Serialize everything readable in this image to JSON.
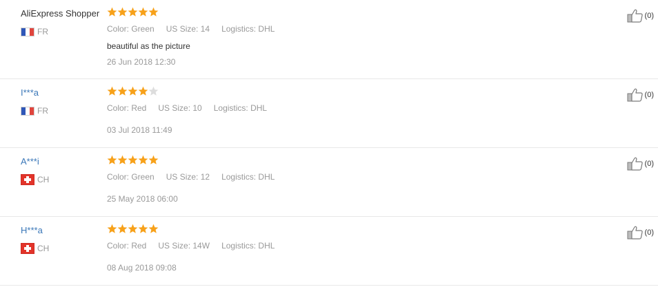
{
  "reviews": [
    {
      "user": "AliExpress Shopper",
      "country": "FR",
      "flag": "france-flag",
      "rating": 5,
      "color": "Color: Green",
      "size": "US Size: 14",
      "logistics": "Logistics: DHL",
      "feedback": "beautiful as the picture",
      "date": "26 Jun 2018 12:30",
      "helpful": "(0)"
    },
    {
      "user": "I***a",
      "country": "FR",
      "flag": "france-flag",
      "rating": 4,
      "color": "Color: Red",
      "size": "US Size: 10",
      "logistics": "Logistics: DHL",
      "feedback": "",
      "date": "03 Jul 2018 11:49",
      "helpful": "(0)"
    },
    {
      "user": "A***i",
      "country": "CH",
      "flag": "switzerland-flag",
      "rating": 5,
      "color": "Color: Green",
      "size": "US Size: 12",
      "logistics": "Logistics: DHL",
      "feedback": "",
      "date": "25 May 2018 06:00",
      "helpful": "(0)"
    },
    {
      "user": "H***a",
      "country": "CH",
      "flag": "switzerland-flag",
      "rating": 5,
      "color": "Color: Red",
      "size": "US Size: 14W",
      "logistics": "Logistics: DHL",
      "feedback": "",
      "date": "08 Aug 2018 09:08",
      "helpful": "(0)"
    }
  ],
  "colors": {
    "star_filled": "#f7a11a",
    "star_empty": "#dddddd",
    "link": "#3a77b8",
    "muted": "#999999"
  }
}
